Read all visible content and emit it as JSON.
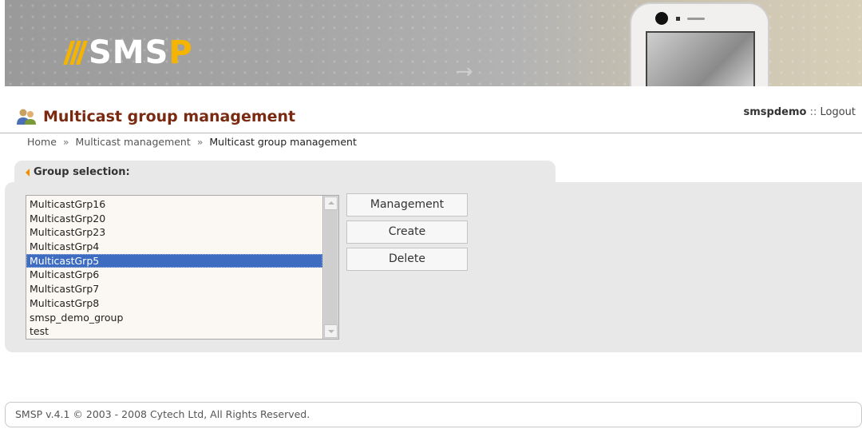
{
  "banner": {
    "logo_text_main": "SMS",
    "logo_text_accent": "P",
    "logo_color": "#f4b400"
  },
  "header": {
    "title": "Multicast group management",
    "title_icon": "users-icon",
    "title_color": "#7a2a10",
    "user": "smspdemo",
    "separator": "::",
    "logout": "Logout"
  },
  "breadcrumb": {
    "items": [
      "Home",
      "Multicast management",
      "Multicast group management"
    ],
    "separator": "»"
  },
  "group_selection": {
    "label": "Group selection:",
    "groups": [
      "MulticastGrp16",
      "MulticastGrp20",
      "MulticastGrp23",
      "MulticastGrp4",
      "MulticastGrp5",
      "MulticastGrp6",
      "MulticastGrp7",
      "MulticastGrp8",
      "smsp_demo_group",
      "test"
    ],
    "selected": "MulticastGrp5",
    "selected_color": "#3d6cc0"
  },
  "actions": {
    "management": "Management",
    "create": "Create",
    "delete": "Delete"
  },
  "footer": {
    "text": "SMSP v.4.1 © 2003 - 2008 Cytech Ltd, All Rights Reserved."
  }
}
